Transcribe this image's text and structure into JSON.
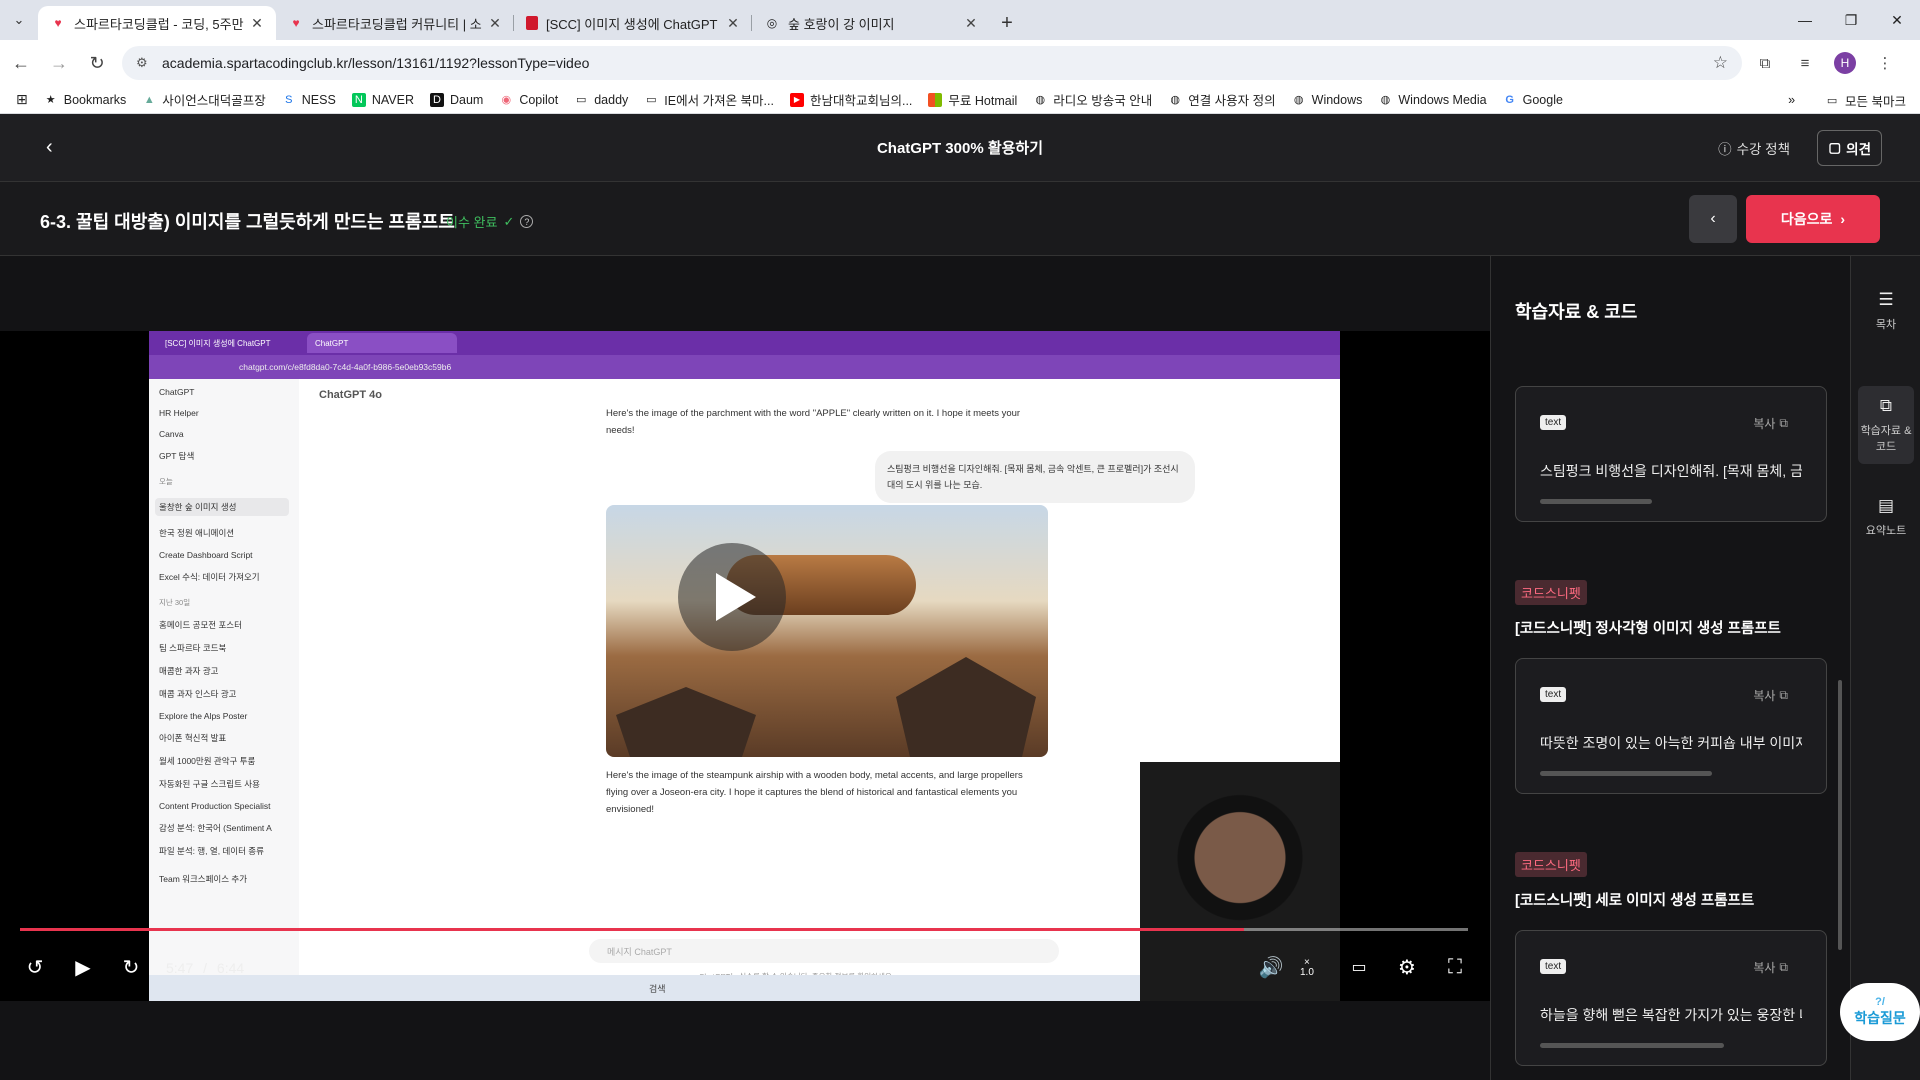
{
  "browser": {
    "tabs": [
      {
        "title": "스파르타코딩클럽 - 코딩, 5주만",
        "active": true,
        "favicon": "heart-icon"
      },
      {
        "title": "스파르타코딩클럽 커뮤니티 | 소",
        "active": false,
        "favicon": "heart-icon"
      },
      {
        "title": "[SCC] 이미지 생성에 ChatGPT",
        "active": false,
        "favicon": "bookmark-red-icon"
      },
      {
        "title": "숲 호랑이 강 이미지",
        "active": false,
        "favicon": "openai-icon"
      }
    ],
    "url": "academia.spartacodingclub.kr/lesson/13161/1192?lessonType=video",
    "profile_initial": "H",
    "bookmarks": [
      "Bookmarks",
      "사이언스대덕골프장",
      "NESS",
      "NAVER",
      "Daum",
      "Copilot",
      "daddy",
      "IE에서 가져온 북마...",
      "한남대학교회님의...",
      "무료 Hotmail",
      "라디오 방송국 안내",
      "연결 사용자 정의",
      "Windows",
      "Windows Media",
      "Google"
    ],
    "bookmarks_overflow": "»",
    "all_bookmarks": "모든 북마크"
  },
  "header": {
    "course_title": "ChatGPT 300% 활용하기",
    "policy": "수강 정책",
    "opinion": "의견"
  },
  "lesson": {
    "title": "6-3. 꿀팁 대방출) 이미지를 그럴듯하게 만드는 프롬프트",
    "status": "이수 완료",
    "next": "다음으로"
  },
  "video": {
    "inner": {
      "tab1": "[SCC] 이미지 생성에 ChatGPT",
      "tab2": "ChatGPT",
      "url": "chatgpt.com/c/e8fd8da0-7c4d-4a0f-b986-5e0eb93c59b6",
      "model": "ChatGPT 4o",
      "sidebar": [
        "ChatGPT",
        "HR Helper",
        "Canva",
        "GPT 탐색"
      ],
      "group_today": "오늘",
      "today_items": [
        "울창한 숲 이미지 생성",
        "한국 정원 애니메이션",
        "Create Dashboard Script",
        "Excel 수식: 데이터 가져오기"
      ],
      "group_30": "지난 30일",
      "past_items": [
        "홈메이드 공모전 포스터",
        "팀 스파르타 코드북",
        "매콤한 과자 광고",
        "매콤 과자 인스타 광고",
        "Explore the Alps Poster",
        "아이폰 혁신적 발표",
        "월세 1000만원 관악구 투룸",
        "자동화된 구글 스크립트 사용",
        "Content Production Specialist",
        "감성 분석: 한국어 (Sentiment A",
        "파일 분석: 행, 열, 데이터 종류"
      ],
      "team": "Team 워크스페이스 추가",
      "msg1": "Here's the image of the parchment with the word \"APPLE\" clearly written on it. I hope it meets your needs!",
      "user_msg": "스팀펑크 비행선을 디자인해줘. [목재 몸체, 금속 악센트, 큰 프로펠러]가 조선시대의 도시 위를 나는 모습.",
      "msg2": "Here's the image of the steampunk airship with a wooden body, metal accents, and large propellers flying over a Joseon-era city. I hope it captures the blend of historical and fantastical elements you envisioned!",
      "input_placeholder": "메시지 ChatGPT",
      "footer": "ChatGPT는 실수를 할 수 있습니다. 중요한 정보를 확인하세요.",
      "taskbar_search": "검색"
    },
    "current_time": "5:47",
    "separator": "/",
    "duration": "6:44",
    "progress_percent": 84.5,
    "speed_icon": "×",
    "speed_value": "1.0"
  },
  "panel": {
    "title": "학습자료 & 코드",
    "cards": [
      {
        "lang": "text",
        "copy": "복사",
        "code": "스팀펑크 비행선을 디자인해줘. [목재 몸체, 금"
      },
      {
        "badge": "코드스니펫",
        "title": "[코드스니펫] 정사각형 이미지 생성 프롬프트",
        "lang": "text",
        "copy": "복사",
        "code": "따뜻한 조명이 있는 아늑한 커피숍 내부 이미지"
      },
      {
        "badge": "코드스니펫",
        "title": "[코드스니펫] 세로 이미지 생성 프롬프트",
        "lang": "text",
        "copy": "복사",
        "code": "하늘을 향해 뻗은 복잡한 가지가 있는 웅장한 나무"
      }
    ],
    "qa_label": "학습질문",
    "qa_mark": "?/"
  },
  "rail": {
    "toc": "목차",
    "materials": "학습자료 & 코드",
    "notes": "요약노트"
  },
  "colors": {
    "accent": "#e8344e",
    "complete": "#3fbf5f"
  }
}
